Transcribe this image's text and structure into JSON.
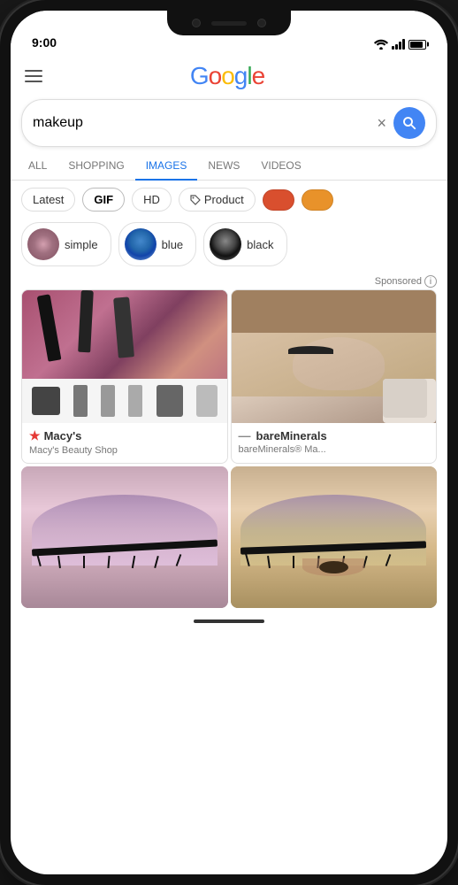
{
  "phone": {
    "status_bar": {
      "time": "9:00"
    }
  },
  "header": {
    "menu_label": "menu",
    "logo": {
      "g1": "G",
      "o1": "o",
      "o2": "o",
      "g2": "g",
      "l": "l",
      "e": "e"
    }
  },
  "search": {
    "query": "makeup",
    "clear_label": "×",
    "search_label": "search"
  },
  "nav_tabs": [
    {
      "label": "ALL",
      "active": false
    },
    {
      "label": "SHOPPING",
      "active": false
    },
    {
      "label": "IMAGES",
      "active": true
    },
    {
      "label": "NEWS",
      "active": false
    },
    {
      "label": "VIDEOS",
      "active": false
    }
  ],
  "filter_chips": [
    {
      "label": "Latest",
      "type": "text"
    },
    {
      "label": "GIF",
      "type": "gif"
    },
    {
      "label": "HD",
      "type": "text"
    },
    {
      "label": "Product",
      "type": "product"
    },
    {
      "label": "",
      "type": "color",
      "color": "#D94F2E"
    },
    {
      "label": "",
      "type": "color",
      "color": "#E8922A"
    }
  ],
  "related_searches": [
    {
      "label": "simple",
      "thumb": "simple"
    },
    {
      "label": "blue",
      "thumb": "blue"
    },
    {
      "label": "black",
      "thumb": "black"
    }
  ],
  "sponsored_text": "Sponsored",
  "products": [
    {
      "store": "Macy's",
      "store_type": "star",
      "sub": "Macy's Beauty Shop"
    },
    {
      "store": "bareMinerals",
      "store_type": "dash",
      "sub": "bareMinerals® Ma..."
    }
  ],
  "bottom_images": [
    {
      "alt": "eye makeup 1"
    },
    {
      "alt": "eye makeup 2"
    }
  ]
}
